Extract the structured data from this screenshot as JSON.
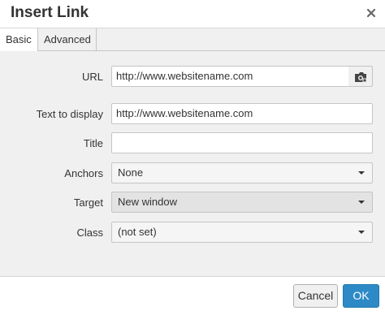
{
  "dialog": {
    "title": "Insert Link",
    "close_icon": "close-icon"
  },
  "tabs": [
    {
      "label": "Basic",
      "active": true
    },
    {
      "label": "Advanced",
      "active": false
    }
  ],
  "form": {
    "url": {
      "label": "URL",
      "value": "http://www.websitename.com",
      "browse_icon": "file-browser-icon"
    },
    "text_to_display": {
      "label": "Text to display",
      "value": "http://www.websitename.com"
    },
    "title": {
      "label": "Title",
      "value": ""
    },
    "anchors": {
      "label": "Anchors",
      "selected": "None"
    },
    "target": {
      "label": "Target",
      "selected": "New window"
    },
    "class": {
      "label": "Class",
      "selected": "(not set)"
    }
  },
  "buttons": {
    "cancel": "Cancel",
    "ok": "OK"
  },
  "colors": {
    "primary_button": "#2d8ac7",
    "panel_background": "#f0f0f0"
  }
}
